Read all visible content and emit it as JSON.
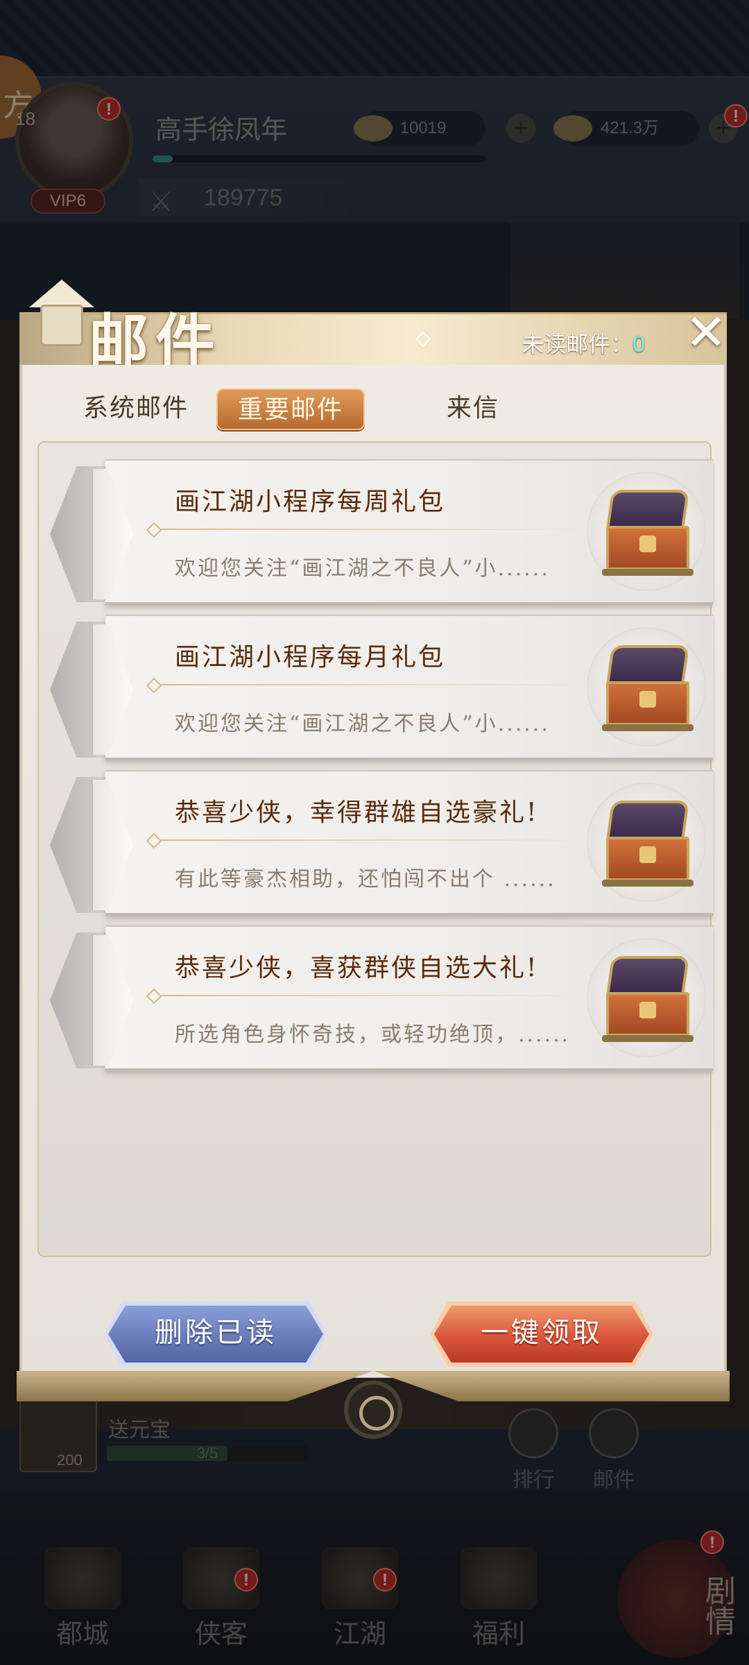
{
  "hud": {
    "compass_char": "方",
    "player_level": "18",
    "vip": "VIP6",
    "player_name": "高手徐凤年",
    "exp_progress": 0.06,
    "gold": "10019",
    "coins": "421.3万",
    "plus": "+",
    "power": "189775",
    "notice_badge": "!"
  },
  "quest": {
    "title": "送元宝",
    "count": "200",
    "progress_text": "3/5",
    "progress": 0.6
  },
  "side_buttons": [
    {
      "label": "排行"
    },
    {
      "label": "邮件"
    }
  ],
  "bottom_nav": [
    {
      "label": "都城"
    },
    {
      "label": "侠客"
    },
    {
      "label": "江湖"
    },
    {
      "label": "福利"
    }
  ],
  "bottom_nav_side": "剧情",
  "dialog": {
    "title": "邮件",
    "unread_label": "未读邮件：",
    "unread_count": "0",
    "close_glyph": "✕",
    "tabs": [
      {
        "label": "系统邮件",
        "active": false
      },
      {
        "label": "重要邮件",
        "active": true
      },
      {
        "label": "来信",
        "active": false
      }
    ],
    "mails": [
      {
        "title": "画江湖小程序每周礼包",
        "preview": "欢迎您关注“画江湖之不良人”小......"
      },
      {
        "title": "画江湖小程序每月礼包",
        "preview": "欢迎您关注“画江湖之不良人”小......"
      },
      {
        "title": "恭喜少侠，幸得群雄自选豪礼!",
        "preview": "有此等豪杰相助，还怕闯不出个 ......"
      },
      {
        "title": "恭喜少侠，喜获群侠自选大礼!",
        "preview": "所选角色身怀奇技，或轻功绝顶，......"
      }
    ],
    "delete_read_label": "删除已读",
    "claim_all_label": "一键领取"
  },
  "colors": {
    "accent_tab": "#c9783c",
    "unread_count": "#6ef0e8",
    "title_text": "#5a2a0a",
    "delete_button": "#6a7cba",
    "claim_button": "#d9553a"
  }
}
